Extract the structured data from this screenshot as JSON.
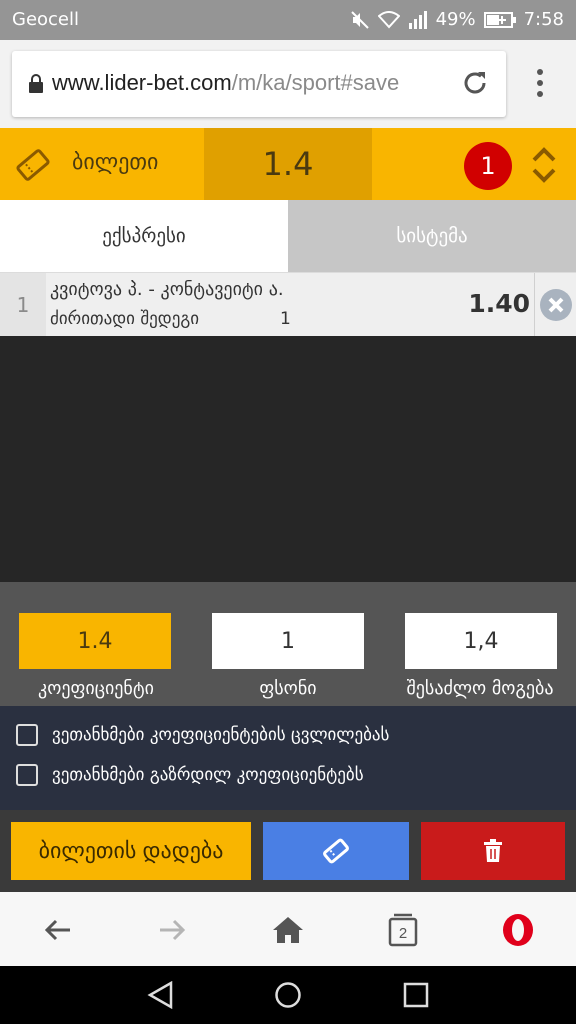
{
  "status_bar": {
    "carrier": "Geocell",
    "battery": "49%",
    "time": "7:58"
  },
  "browser": {
    "url_host": "www.lider-bet.com",
    "url_path": "/m/ka/sport#save"
  },
  "ticket": {
    "title": "ბილეთი",
    "total_odds": "1.4",
    "count": "1"
  },
  "tabs": {
    "express": "ექსპრესი",
    "system": "სისტემა"
  },
  "bet": {
    "index": "1",
    "match": "კვიტოვა პ. - კონტავეიტი ა.",
    "market": "ძირითადი შედეგი",
    "outcome": "1",
    "odds": "1.40"
  },
  "summary": {
    "odds_value": "1.4",
    "stake_value": "1",
    "win_value": "1,4",
    "odds_label": "კოეფიციენტი",
    "stake_label": "ფსონი",
    "win_label": "შესაძლო მოგება"
  },
  "options": {
    "accept_changes": "ვეთანხმები კოეფიციენტების ცვლილებას",
    "accept_increased": "ვეთანხმები გაზრდილ კოეფიციენტებს"
  },
  "actions": {
    "place_bet": "ბილეთის დადება"
  },
  "browser_nav": {
    "tabs_count": "2"
  },
  "colors": {
    "accent": "#f9b500",
    "accent_dark": "#e0a000",
    "badge": "#d10000",
    "blue_button": "#4a7fe4",
    "red_button": "#c91b1b"
  }
}
